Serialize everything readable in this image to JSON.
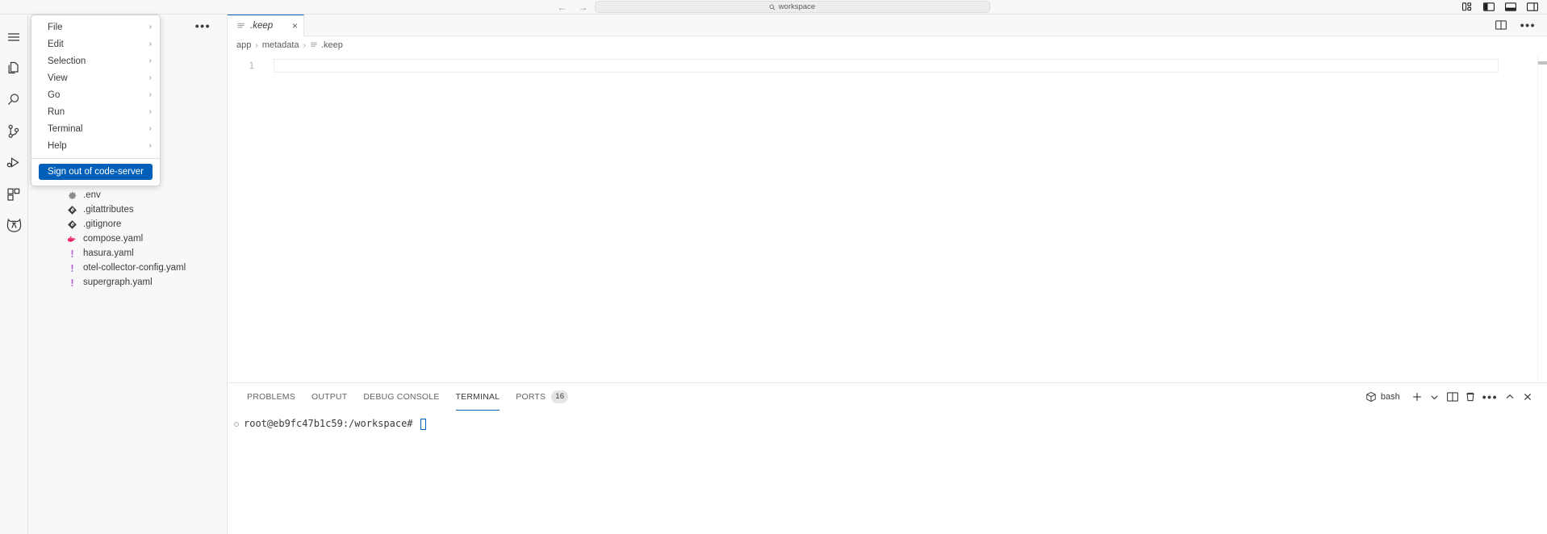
{
  "titlebar": {
    "back_icon": "arrow-left-icon",
    "forward_icon": "arrow-right-icon",
    "back_glyph": "←",
    "forward_glyph": "→",
    "command_center_text": "workspace",
    "layout_icons": [
      "customize-layout-icon",
      "toggle-primary-sidebar-icon",
      "toggle-panel-icon",
      "toggle-secondary-sidebar-icon"
    ]
  },
  "activitybar": {
    "items": [
      {
        "name": "menu-icon",
        "label": "Menu"
      },
      {
        "name": "explorer-icon",
        "label": "Explorer"
      },
      {
        "name": "search-icon",
        "label": "Search"
      },
      {
        "name": "source-control-icon",
        "label": "Source Control"
      },
      {
        "name": "run-and-debug-icon",
        "label": "Run and Debug"
      },
      {
        "name": "extensions-icon",
        "label": "Extensions"
      },
      {
        "name": "hasura-ddn-icon",
        "label": "Hasura DDN"
      }
    ]
  },
  "menu": {
    "items": [
      {
        "label": "File",
        "chevron": "›"
      },
      {
        "label": "Edit",
        "chevron": "›"
      },
      {
        "label": "Selection",
        "chevron": "›"
      },
      {
        "label": "View",
        "chevron": "›"
      },
      {
        "label": "Go",
        "chevron": "›"
      },
      {
        "label": "Run",
        "chevron": "›"
      },
      {
        "label": "Terminal",
        "chevron": "›"
      },
      {
        "label": "Help",
        "chevron": "›"
      }
    ],
    "signout_label": "Sign out of code-server",
    "signout_color": "#005FB8"
  },
  "sidebar": {
    "more_actions_label": "•••",
    "files": [
      {
        "label": ".env",
        "icon": "gear-file-icon",
        "color": "#8a8a8a"
      },
      {
        "label": ".gitattributes",
        "icon": "git-file-icon",
        "color": "#3b3b3b"
      },
      {
        "label": ".gitignore",
        "icon": "git-file-icon",
        "color": "#3b3b3b"
      },
      {
        "label": "compose.yaml",
        "icon": "docker-file-icon",
        "color": "#e91e63"
      },
      {
        "label": "hasura.yaml",
        "icon": "yaml-file-icon",
        "color": "#b05bd6"
      },
      {
        "label": "otel-collector-config.yaml",
        "icon": "yaml-file-icon",
        "color": "#b05bd6"
      },
      {
        "label": "supergraph.yaml",
        "icon": "yaml-file-icon",
        "color": "#b05bd6"
      }
    ]
  },
  "editor": {
    "tab": {
      "label": ".keep",
      "icon": "text-file-icon",
      "close_glyph": "×"
    },
    "actions": [
      "split-editor-icon",
      "more-actions-icon"
    ],
    "breadcrumb": [
      {
        "label": "app",
        "icon": null
      },
      {
        "label": "metadata",
        "icon": null
      },
      {
        "label": ".keep",
        "icon": "text-file-icon"
      }
    ],
    "breadcrumb_separator": "›",
    "line_numbers": [
      "1"
    ],
    "content_lines": [
      ""
    ]
  },
  "panel": {
    "tabs": [
      {
        "label": "PROBLEMS",
        "active": false,
        "badge": null
      },
      {
        "label": "OUTPUT",
        "active": false,
        "badge": null
      },
      {
        "label": "DEBUG CONSOLE",
        "active": false,
        "badge": null
      },
      {
        "label": "TERMINAL",
        "active": true,
        "badge": null
      },
      {
        "label": "PORTS",
        "active": false,
        "badge": "16"
      }
    ],
    "active_tab_underline_color": "#005FB8",
    "shell_label": "bash",
    "shell_icon": "terminal-bash-icon",
    "actions": [
      {
        "name": "new-terminal-icon",
        "glyph": "+"
      },
      {
        "name": "chevron-down-icon",
        "glyph": "⌄"
      },
      {
        "name": "split-terminal-icon",
        "glyph": ""
      },
      {
        "name": "kill-terminal-icon",
        "glyph": ""
      },
      {
        "name": "terminal-more-actions-icon",
        "glyph": "•••"
      },
      {
        "name": "maximize-panel-icon",
        "glyph": "^"
      },
      {
        "name": "close-panel-icon",
        "glyph": "×"
      }
    ],
    "terminal": {
      "prompt": "root@eb9fc47b1c59:/workspace#",
      "cursor_color": "#005FB8"
    }
  }
}
